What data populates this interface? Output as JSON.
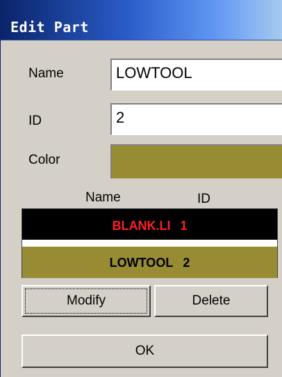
{
  "window": {
    "title": "Edit Part"
  },
  "form": {
    "name_label": "Name",
    "name_value": "LOWTOOL",
    "id_label": "ID",
    "id_value": "2",
    "color_label": "Color",
    "color_value": "#978b33"
  },
  "parts_list": {
    "columns": [
      "Name",
      "ID"
    ],
    "rows": [
      {
        "name": "BLANK.LI",
        "id": "1",
        "text_color": "#ff2020",
        "bg_color": "#000000"
      },
      {
        "name": "LOWTOOL",
        "id": "2",
        "text_color": "#000000",
        "bg_color": "#978b33"
      }
    ]
  },
  "buttons": {
    "modify": "Modify",
    "delete": "Delete",
    "ok": "OK"
  }
}
